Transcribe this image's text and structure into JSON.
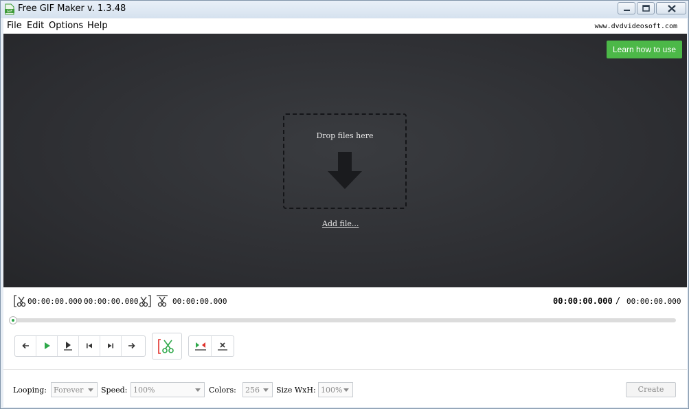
{
  "window": {
    "title": "Free GIF Maker v. 1.3.48"
  },
  "menu": {
    "file": "File",
    "edit": "Edit",
    "options": "Options",
    "help": "Help",
    "site": "www.dvdvideosoft.com"
  },
  "preview": {
    "learn_button": "Learn how to use",
    "drop_text": "Drop files here",
    "add_file": "Add file..."
  },
  "trim": {
    "start_time": "00:00:00.000",
    "end_time": "00:00:00.000",
    "duration_time": "00:00:00.000",
    "current_time": "00:00:00.000",
    "separator": "/",
    "total_time": "00:00:00.000",
    "progress": 0
  },
  "options": {
    "looping_label": "Looping:",
    "looping_value": "Forever",
    "speed_label": "Speed:",
    "speed_value": "100%",
    "colors_label": "Colors:",
    "colors_value": "256",
    "size_label": "Size WxH:",
    "size_value": "100%",
    "create_label": "Create"
  },
  "colors": {
    "accent_green": "#4cb848",
    "preview_bg": "#2c2d31",
    "cut_red": "#e0302a"
  }
}
